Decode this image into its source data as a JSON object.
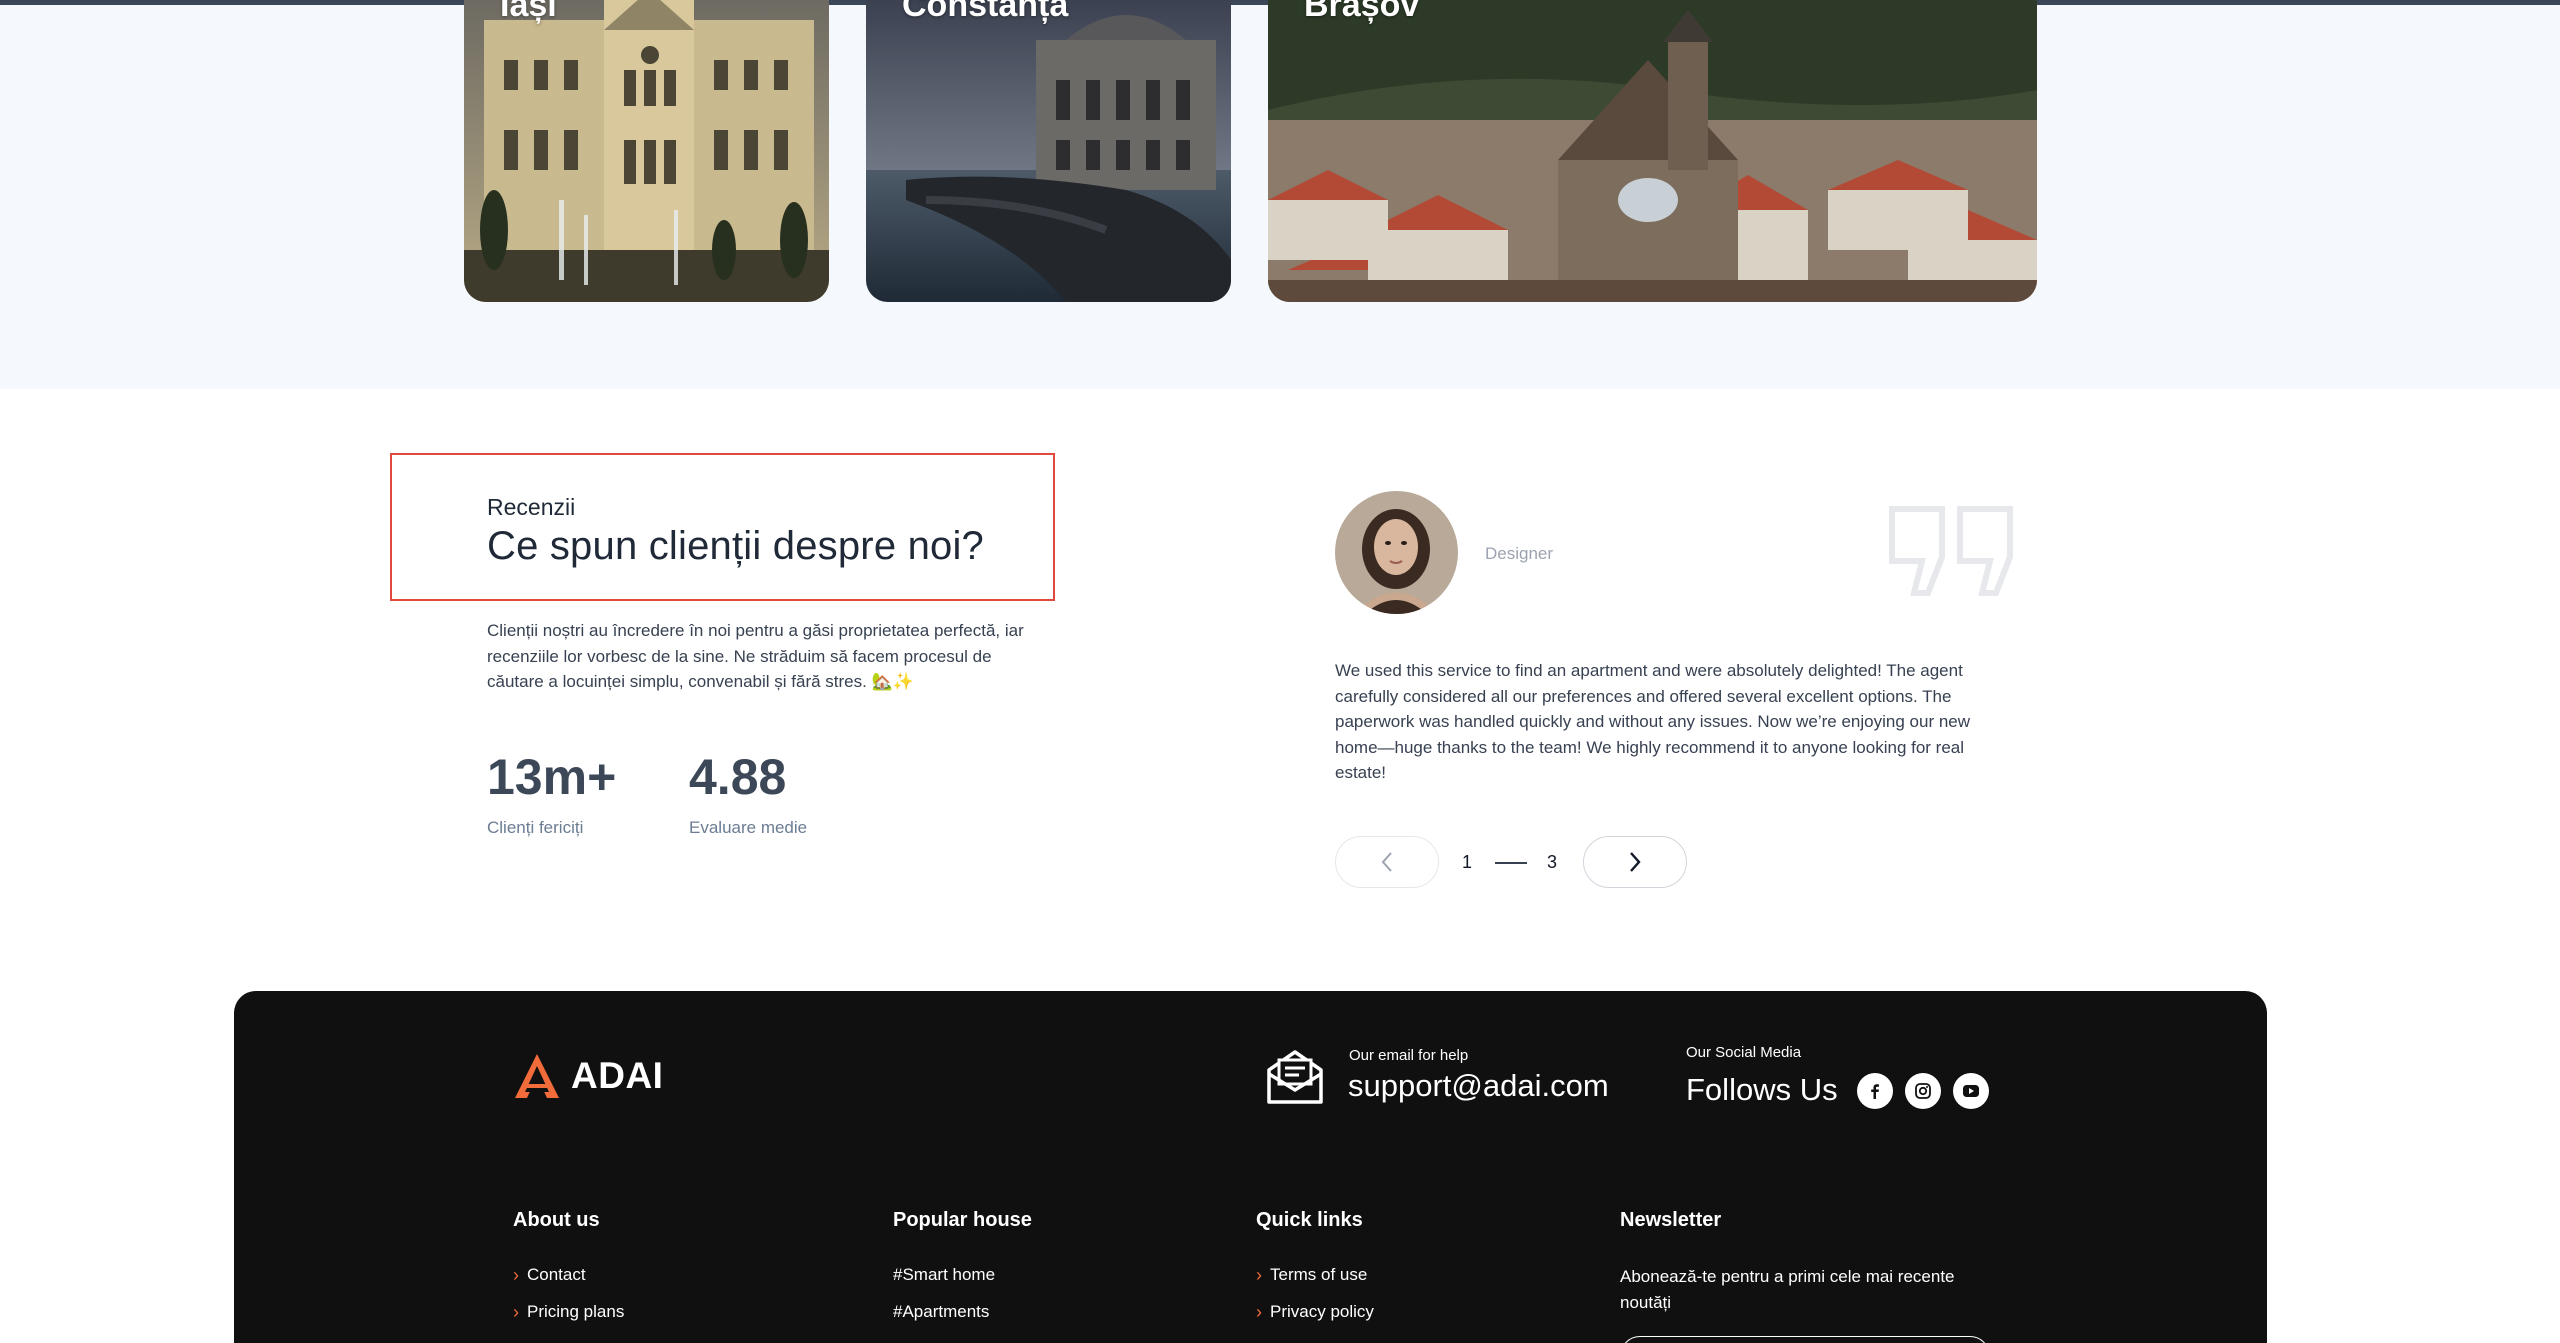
{
  "gallery": {
    "cities": [
      {
        "name": "Iași",
        "image": "iasi-palace-photo"
      },
      {
        "name": "Constanța",
        "image": "constanta-casino-photo"
      },
      {
        "name": "Brașov",
        "image": "brasov-old-town-photo"
      }
    ]
  },
  "reviews": {
    "eyebrow": "Recenzii",
    "title": "Ce spun clienții despre noi?",
    "description": "Clienții noștri au încredere în noi pentru a găsi proprietatea perfectă, iar recenziile lor vorbesc de la sine. Ne străduim să facem procesul de căutare a locuinței simplu, convenabil și fără stres. 🏡✨",
    "stats": [
      {
        "value": "13m+",
        "label": "Clienți fericiți"
      },
      {
        "value": "4.88",
        "label": "Evaluare medie"
      }
    ],
    "testimonial": {
      "role": "Designer",
      "text": "We used this service to find an apartment and were absolutely delighted! The agent carefully considered all our preferences and offered several excellent options. The paperwork was handled quickly and without any issues. Now we’re enjoying our new home—huge thanks to the team! We highly recommend it to anyone looking for real estate!"
    },
    "pager": {
      "current": "1",
      "total": "3"
    }
  },
  "footer": {
    "brand": "ADAI",
    "help_label": "Our email for help",
    "help_email": "support@adai.com",
    "social_label": "Our Social Media",
    "social_title": "Follows Us",
    "social_icons": [
      "facebook-icon",
      "instagram-icon",
      "youtube-icon"
    ],
    "columns": {
      "about": {
        "title": "About us",
        "links": [
          "Contact",
          "Pricing plans"
        ]
      },
      "popular": {
        "title": "Popular house",
        "links": [
          "#Smart home",
          "#Apartments"
        ]
      },
      "quick": {
        "title": "Quick links",
        "links": [
          "Terms of use",
          "Privacy policy"
        ]
      },
      "newsletter": {
        "title": "Newsletter",
        "text": "Abonează-te pentru a primi cele mai recente noutăți"
      }
    }
  },
  "colors": {
    "accent": "#f26b3a",
    "highlight_border": "#e0493b",
    "footer_bg": "#101010",
    "band_bg": "#f5f8fc"
  }
}
